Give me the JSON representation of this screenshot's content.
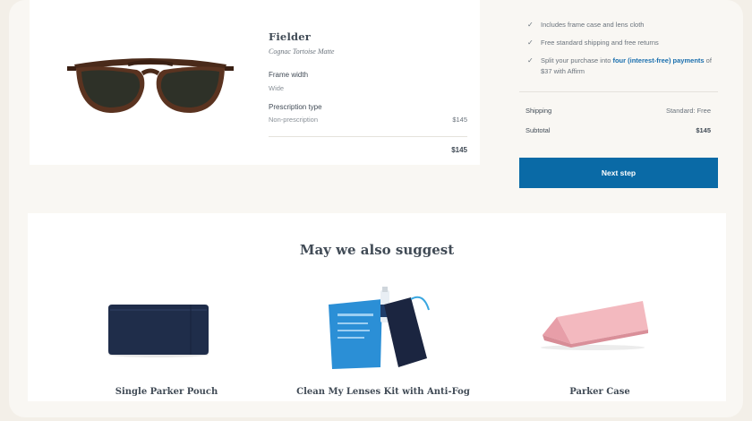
{
  "product": {
    "name": "Fielder",
    "color": "Cognac Tortoise Matte",
    "frame_width_label": "Frame width",
    "frame_width_value": "Wide",
    "prescription_label": "Prescription type",
    "prescription_value": "Non-prescription",
    "prescription_price": "$145",
    "total": "$145",
    "image_icon": "sunglasses-image"
  },
  "benefits": {
    "case_text": "Includes frame case and lens cloth",
    "shipping_text": "Free standard shipping and free returns",
    "affirm_prefix": "Split your purchase into ",
    "affirm_link": "four (interest-free) payments",
    "affirm_suffix": " of $37 with Affirm"
  },
  "summary": {
    "shipping_label": "Shipping",
    "shipping_value": "Standard: Free",
    "subtotal_label": "Subtotal",
    "subtotal_value": "$145"
  },
  "next_button": "Next step",
  "suggestions": {
    "title": "May we also suggest",
    "items": [
      {
        "name": "Single Parker Pouch",
        "icon": "pouch-image"
      },
      {
        "name": "Clean My Lenses Kit with Anti-Fog",
        "icon": "lens-kit-image"
      },
      {
        "name": "Parker Case",
        "icon": "case-image"
      }
    ]
  },
  "colors": {
    "accent": "#0a6aa6",
    "link": "#1a6fae",
    "background": "#f9f7f3",
    "text": "#414b56"
  }
}
